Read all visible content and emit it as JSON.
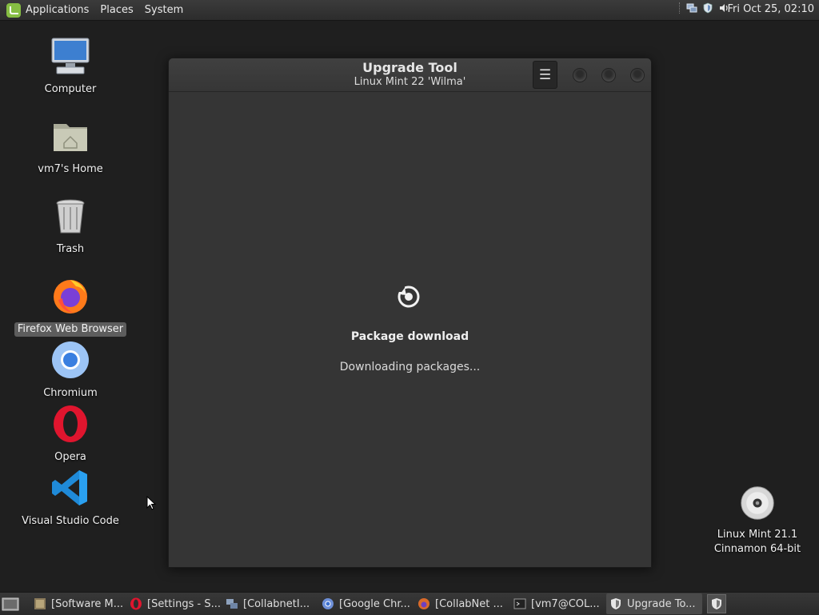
{
  "top_panel": {
    "menus": [
      "Applications",
      "Places",
      "System"
    ],
    "clock": "Fri Oct 25, 02:10"
  },
  "desktop": {
    "icons": [
      {
        "label": "Computer",
        "icon": "computer-icon"
      },
      {
        "label": "vm7's Home",
        "icon": "home-folder-icon"
      },
      {
        "label": "Trash",
        "icon": "trash-icon"
      },
      {
        "label": "Firefox Web Browser",
        "icon": "firefox-icon"
      },
      {
        "label": "Chromium",
        "icon": "chromium-icon"
      },
      {
        "label": "Opera",
        "icon": "opera-icon"
      },
      {
        "label": "Visual Studio Code",
        "icon": "vscode-icon"
      }
    ],
    "disc": {
      "line1": "Linux Mint 21.1",
      "line2": "Cinnamon 64-bit",
      "icon": "optical-disc-icon"
    }
  },
  "window": {
    "title": "Upgrade Tool",
    "subtitle": "Linux Mint 22 'Wilma'",
    "stage_title": "Package download",
    "stage_status": "Downloading packages..."
  },
  "taskbar": {
    "tasks": [
      {
        "label": "[Software M...",
        "icon": "software-manager-icon"
      },
      {
        "label": "[Settings - S...",
        "icon": "opera-icon"
      },
      {
        "label": "[CollabnetI...",
        "icon": "network-icon"
      },
      {
        "label": "[Google Chr...",
        "icon": "chrome-icon"
      },
      {
        "label": "[CollabNet ...",
        "icon": "firefox-icon"
      },
      {
        "label": "[vm7@COL...",
        "icon": "terminal-icon"
      },
      {
        "label": "Upgrade To...",
        "icon": "shield-icon"
      }
    ],
    "active_index": 6
  },
  "colors": {
    "desktop_bg": "#1f1f1f",
    "window_bg": "#353535",
    "mint_green": "#86be43"
  }
}
